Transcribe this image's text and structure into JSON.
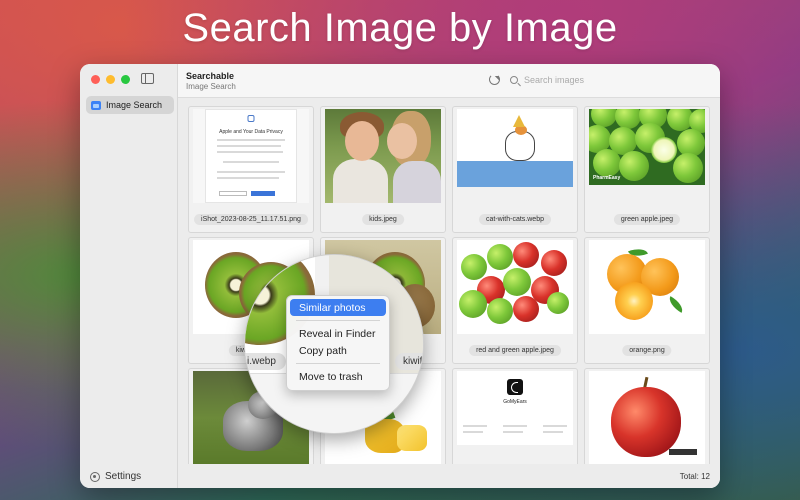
{
  "headline": "Search Image by Image",
  "colors": {
    "accent": "#3d7ef0",
    "traffic_red": "#fe5f57",
    "traffic_yellow": "#febc2e",
    "traffic_green": "#28c840"
  },
  "sidebar": {
    "items": [
      {
        "label": "Image Search",
        "icon": "image-icon",
        "selected": true
      }
    ],
    "settings_label": "Settings"
  },
  "toolbar": {
    "title": "Searchable",
    "subtitle": "Image Search",
    "search_placeholder": "Search images",
    "search_value": ""
  },
  "grid": {
    "items": [
      {
        "caption": "iShot_2023-08-25_11.17.51.png",
        "doc_title": "Apple and Your Data Privacy"
      },
      {
        "caption": "kids.jpeg"
      },
      {
        "caption": "cat-with-cats.webp"
      },
      {
        "caption": "green apple.jpeg",
        "brand": "PharmEasy"
      },
      {
        "caption": "kiwi.webp"
      },
      {
        "caption": "kiwifruit"
      },
      {
        "caption": "red and  green apple.jpeg"
      },
      {
        "caption": "orange.png"
      },
      {
        "caption": ""
      },
      {
        "caption": ""
      },
      {
        "caption": "",
        "doc_title": "GoMyEars"
      },
      {
        "caption": ""
      }
    ]
  },
  "lens_captions": {
    "left": "i.webp",
    "right": "kiwifru"
  },
  "context_menu": {
    "items": [
      {
        "label": "Similar photos",
        "selected": true
      },
      {
        "label": "Reveal in Finder"
      },
      {
        "label": "Copy path"
      },
      {
        "label": "Move to trash"
      }
    ]
  },
  "footer": {
    "total": "Total: 12"
  }
}
